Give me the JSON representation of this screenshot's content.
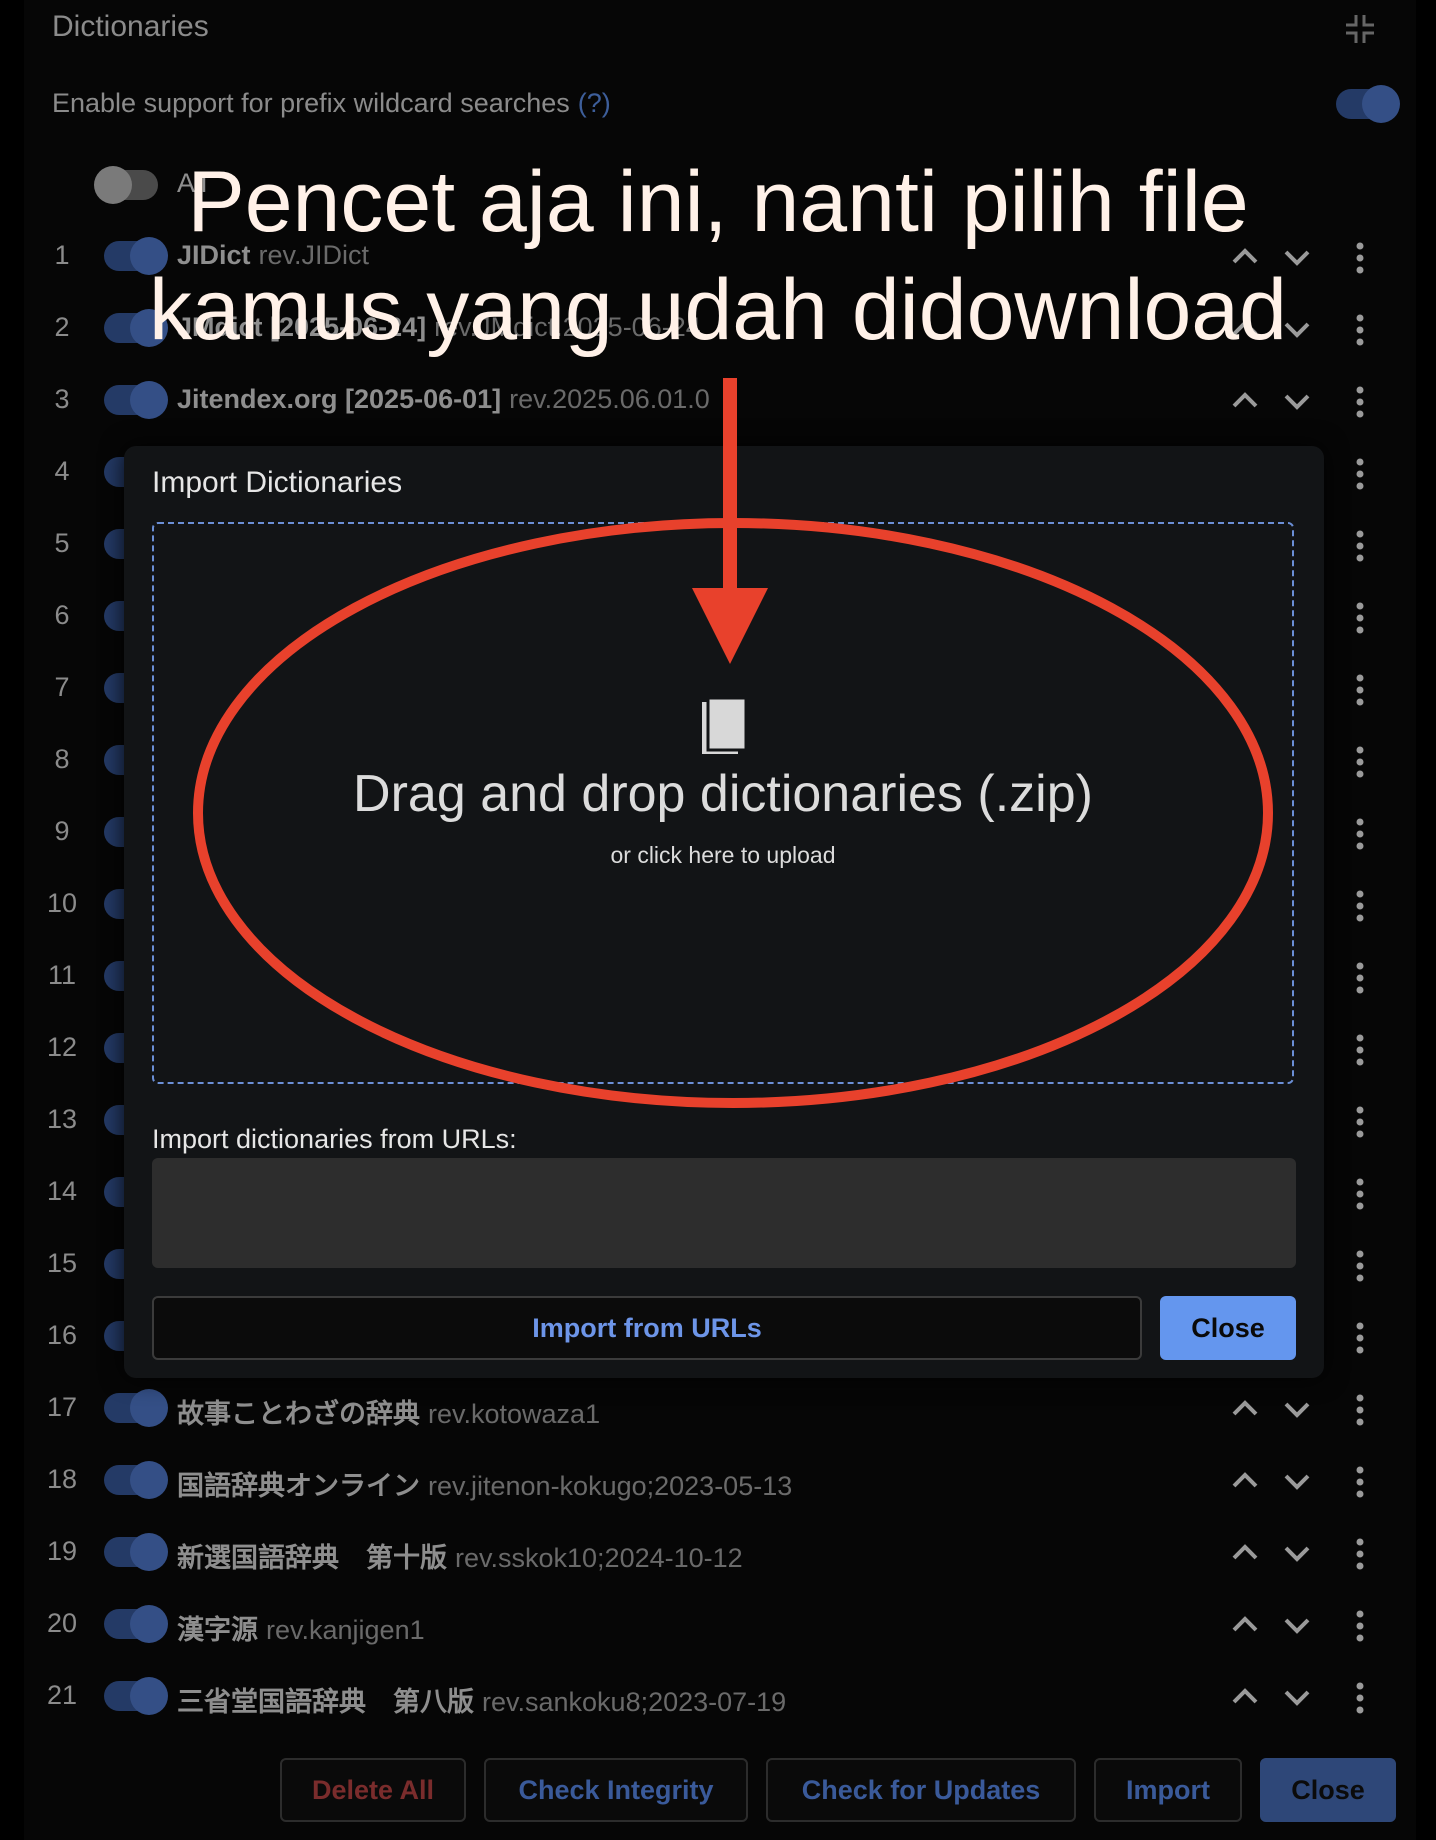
{
  "header": {
    "title": "Dictionaries",
    "collapse_icon": "collapse-icon"
  },
  "settings": {
    "prefix_wildcard_label": "Enable support for prefix wildcard searches",
    "prefix_wildcard_help": "(?)",
    "prefix_wildcard_enabled": true,
    "all_toggle_label": "All",
    "all_toggle_enabled": false
  },
  "dictionaries": [
    {
      "index": "1",
      "name": "JIDict",
      "revision": "rev.JIDict",
      "enabled": true
    },
    {
      "index": "2",
      "name": "JMdict [2025-06-24]",
      "revision": "rev.JMdict.2025-06-24",
      "enabled": true
    },
    {
      "index": "3",
      "name": "Jitendex.org [2025-06-01]",
      "revision": "rev.2025.06.01.0",
      "enabled": true
    },
    {
      "index": "4",
      "name": "",
      "revision": "",
      "enabled": true
    },
    {
      "index": "5",
      "name": "",
      "revision": "",
      "enabled": true
    },
    {
      "index": "6",
      "name": "",
      "revision": "",
      "enabled": true
    },
    {
      "index": "7",
      "name": "",
      "revision": "",
      "enabled": true
    },
    {
      "index": "8",
      "name": "",
      "revision": "",
      "enabled": true
    },
    {
      "index": "9",
      "name": "",
      "revision": "",
      "enabled": true
    },
    {
      "index": "10",
      "name": "",
      "revision": "",
      "enabled": true
    },
    {
      "index": "11",
      "name": "",
      "revision": "",
      "enabled": true
    },
    {
      "index": "12",
      "name": "",
      "revision": "",
      "enabled": true
    },
    {
      "index": "13",
      "name": "",
      "revision": "",
      "enabled": true
    },
    {
      "index": "14",
      "name": "",
      "revision": "",
      "enabled": true
    },
    {
      "index": "15",
      "name": "",
      "revision": "",
      "enabled": true
    },
    {
      "index": "16",
      "name": "",
      "revision": "",
      "enabled": true
    },
    {
      "index": "17",
      "name": "故事ことわざの辞典",
      "revision": "rev.kotowaza1",
      "enabled": true
    },
    {
      "index": "18",
      "name": "国語辞典オンライン",
      "revision": "rev.jitenon-kokugo;2023-05-13",
      "enabled": true
    },
    {
      "index": "19",
      "name": "新選国語辞典　第十版",
      "revision": "rev.sskok10;2024-10-12",
      "enabled": true
    },
    {
      "index": "20",
      "name": "漢字源",
      "revision": "rev.kanjigen1",
      "enabled": true
    },
    {
      "index": "21",
      "name": "三省堂国語辞典　第八版",
      "revision": "rev.sankoku8;2023-07-19",
      "enabled": true
    }
  ],
  "modal": {
    "title": "Import Dictionaries",
    "dropzone_icon": "book-icon",
    "dropzone_title": "Drag and drop dictionaries (.zip)",
    "dropzone_subtitle": "or click here to upload",
    "url_label": "Import dictionaries from URLs:",
    "url_value": "",
    "import_urls_button": "Import from URLs",
    "close_button": "Close"
  },
  "footer": {
    "delete_all": "Delete All",
    "check_integrity": "Check Integrity",
    "check_updates": "Check for Updates",
    "import": "Import",
    "close": "Close"
  },
  "annotation": {
    "line1": "Pencet aja ini, nanti pilih file",
    "line2": "kamus yang udah didownload",
    "color": "#e8412c"
  }
}
